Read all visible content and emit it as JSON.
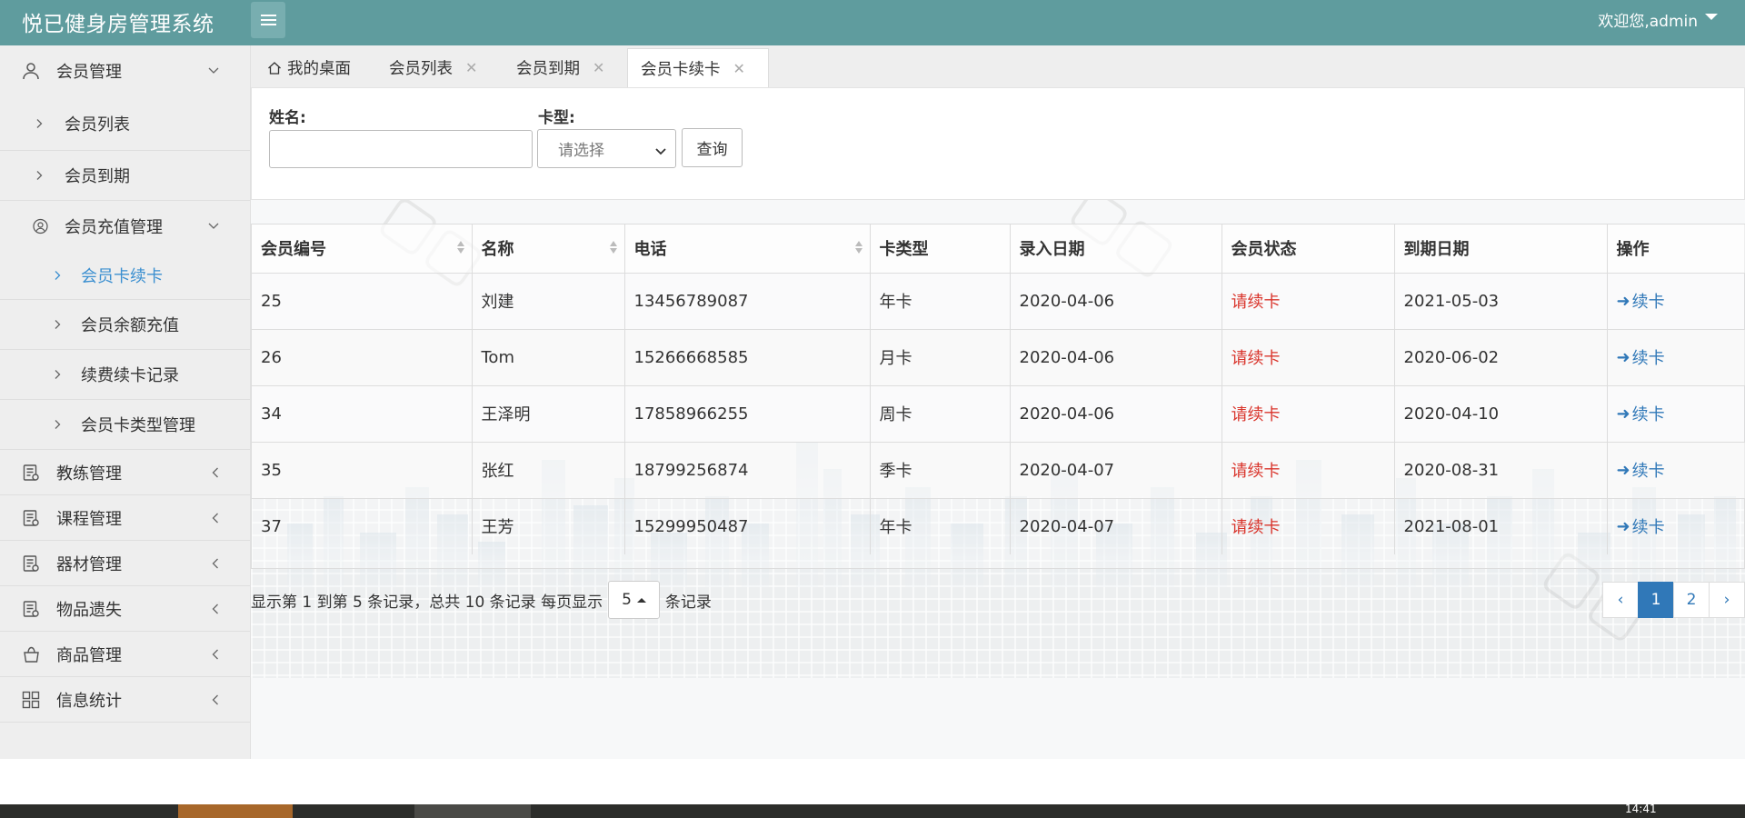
{
  "header": {
    "brand": "悦已健身房管理系统",
    "welcome": "欢迎您,admin"
  },
  "sidebar": {
    "items": [
      {
        "label": "会员管理",
        "icon": "user-icon",
        "expanded": true
      },
      {
        "label": "会员列表"
      },
      {
        "label": "会员到期"
      },
      {
        "label": "会员充值管理",
        "icon": "user-circle-icon",
        "expanded": true
      },
      {
        "label": "会员卡续卡",
        "active": true
      },
      {
        "label": "会员余额充值"
      },
      {
        "label": "续费续卡记录"
      },
      {
        "label": "会员卡类型管理"
      },
      {
        "label": "教练管理",
        "icon": "clipboard-icon"
      },
      {
        "label": "课程管理",
        "icon": "clipboard-icon"
      },
      {
        "label": "器材管理",
        "icon": "clipboard-icon"
      },
      {
        "label": "物品遗失",
        "icon": "clipboard-icon"
      },
      {
        "label": "商品管理",
        "icon": "bag-icon"
      },
      {
        "label": "信息统计",
        "icon": "grid-icon"
      }
    ]
  },
  "tabs": [
    {
      "label": "我的桌面",
      "icon": "home-icon"
    },
    {
      "label": "会员列表",
      "closable": true
    },
    {
      "label": "会员到期",
      "closable": true
    },
    {
      "label": "会员卡续卡",
      "closable": true,
      "active": true
    }
  ],
  "search": {
    "name_label": "姓名:",
    "name_value": "",
    "card_label": "卡型:",
    "card_placeholder": "请选择",
    "query_button": "查询"
  },
  "table": {
    "columns": [
      "会员编号",
      "名称",
      "电话",
      "卡类型",
      "录入日期",
      "会员状态",
      "到期日期",
      "操作"
    ],
    "rows": [
      {
        "id": "25",
        "name": "刘建",
        "phone": "13456789087",
        "card": "年卡",
        "entry": "2020-04-06",
        "status": "请续卡",
        "expire": "2021-05-03",
        "action": "续卡"
      },
      {
        "id": "26",
        "name": "Tom",
        "phone": "15266668585",
        "card": "月卡",
        "entry": "2020-04-06",
        "status": "请续卡",
        "expire": "2020-06-02",
        "action": "续卡"
      },
      {
        "id": "34",
        "name": "王泽明",
        "phone": "17858966255",
        "card": "周卡",
        "entry": "2020-04-06",
        "status": "请续卡",
        "expire": "2020-04-10",
        "action": "续卡"
      },
      {
        "id": "35",
        "name": "张红",
        "phone": "18799256874",
        "card": "季卡",
        "entry": "2020-04-07",
        "status": "请续卡",
        "expire": "2020-08-31",
        "action": "续卡"
      },
      {
        "id": "37",
        "name": "王芳",
        "phone": "15299950487",
        "card": "年卡",
        "entry": "2020-04-07",
        "status": "请续卡",
        "expire": "2021-08-01",
        "action": "续卡"
      }
    ]
  },
  "pager": {
    "info_prefix": "显示第 1 到第 5 条记录，总共 10 条记录 每页显示",
    "page_size": "5",
    "info_suffix": "条记录",
    "prev": "‹",
    "pages": [
      "1",
      "2"
    ],
    "current": "1",
    "next": "›"
  },
  "taskbar": {
    "clock": "14:41"
  },
  "colors": {
    "header": "#5f9c9e",
    "active_link": "#3b8fd0",
    "status_red": "#d9342b",
    "primary_blue": "#3078b8"
  }
}
